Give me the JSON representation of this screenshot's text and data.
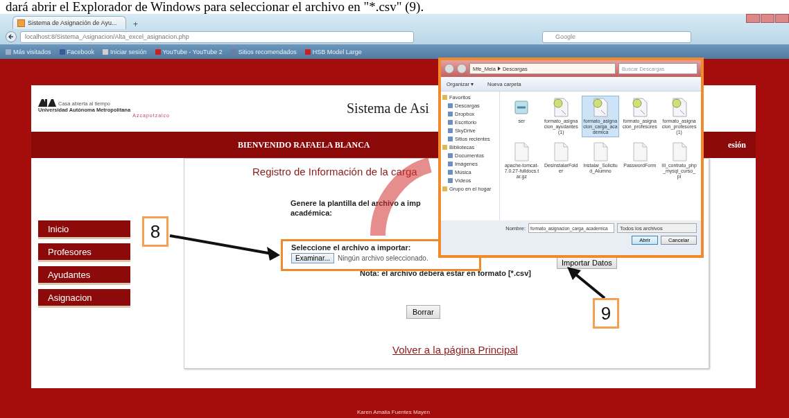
{
  "doc_text": "dará abrir el Explorador de Windows para seleccionar el archivo en \"*.csv\" (9).",
  "browser": {
    "tab_title": "Sistema de Asignación de Ayu...",
    "new_tab": "+",
    "url": "localhost:8/Sistema_Asignacion/Alta_excel_asignacion.php",
    "search_placeholder": "Google",
    "bookmarks": [
      {
        "label": "Más visitados",
        "color": "#9ab0c8"
      },
      {
        "label": "Facebook",
        "color": "#3b5998"
      },
      {
        "label": "Iniciar sesión",
        "color": "#d0d0d0"
      },
      {
        "label": "YouTube - YouTube 2",
        "color": "#cc2020"
      },
      {
        "label": "Sitios recomendados",
        "color": "#6a7fa0"
      },
      {
        "label": "HSB Model Large",
        "color": "#cc2020"
      }
    ]
  },
  "page": {
    "tagline": "Casa abierta al tiempo",
    "university": "Universidad Autónoma Metropolitana",
    "campus": "Azcapotzalco",
    "title": "Sistema de Asi",
    "welcome": "BIENVENIDO RAFAELA BLANCA",
    "logout": "esión",
    "menu": [
      {
        "label": "Inicio"
      },
      {
        "label": "Profesores"
      },
      {
        "label": "Ayudantes"
      },
      {
        "label": "Asignacion"
      }
    ],
    "heading": "Registro de Información de la carga",
    "instruction": "Genere la plantilla del archivo a imp\nacadémica:",
    "select_label": "Seleccione el archivo a importar:",
    "browse_button": "Examinar...",
    "file_status": "Ningún archivo seleccionado.",
    "import_button": "Importar Datos",
    "note": "Nota: el archivo deberá estar en formato [*.csv]",
    "clear_button": "Borrar",
    "back_link": "Volver a la página Principal",
    "footer": "Karen Amalia Fuentes Mayen"
  },
  "dialog": {
    "path": [
      "Mfe_Mela",
      "Descargas"
    ],
    "search_placeholder": "Buscar Descargas",
    "organize": "Organizar ▾",
    "new_folder": "Nueva carpeta",
    "nav": [
      {
        "label": "Favoritos",
        "kind": "group"
      },
      {
        "label": "Descargas",
        "kind": "item"
      },
      {
        "label": "Dropbox",
        "kind": "item"
      },
      {
        "label": "Escritorio",
        "kind": "item"
      },
      {
        "label": "SkyDrive",
        "kind": "item"
      },
      {
        "label": "Sitios recientes",
        "kind": "item"
      },
      {
        "label": "Bibliotecas",
        "kind": "group"
      },
      {
        "label": "Documentos",
        "kind": "item"
      },
      {
        "label": "Imágenes",
        "kind": "item"
      },
      {
        "label": "Música",
        "kind": "item"
      },
      {
        "label": "Vídeos",
        "kind": "item"
      },
      {
        "label": "Grupo en el hogar",
        "kind": "group"
      }
    ],
    "files": [
      {
        "name": "ser",
        "kind": "app",
        "selected": false
      },
      {
        "name": "formato_asignacion_ayudantes (1)",
        "kind": "sheet",
        "selected": false
      },
      {
        "name": "formato_asignacion_carga_academica",
        "kind": "sheet",
        "selected": true
      },
      {
        "name": "formato_asignacion_profesores",
        "kind": "sheet",
        "selected": false
      },
      {
        "name": "formato_asignacion_profesores (1)",
        "kind": "sheet",
        "selected": false
      },
      {
        "name": "apache-tomcat-7.0.27-fulldocs.tar.gz",
        "kind": "doc",
        "selected": false
      },
      {
        "name": "DesinstalarFolder",
        "kind": "doc",
        "selected": false
      },
      {
        "name": "Instalar_Solicitud_Alumno",
        "kind": "doc",
        "selected": false
      },
      {
        "name": "PasswordForm",
        "kind": "doc",
        "selected": false
      },
      {
        "name": "III_contrato_php_mysql_curso_pi",
        "kind": "doc",
        "selected": false
      }
    ],
    "name_label": "Nombre:",
    "file_name": "formato_asignacion_carga_academica",
    "filter": "Todos los archivos",
    "open_button": "Abrir",
    "cancel_button": "Cancelar"
  },
  "callouts": [
    {
      "label": "8"
    },
    {
      "label": "9"
    }
  ]
}
